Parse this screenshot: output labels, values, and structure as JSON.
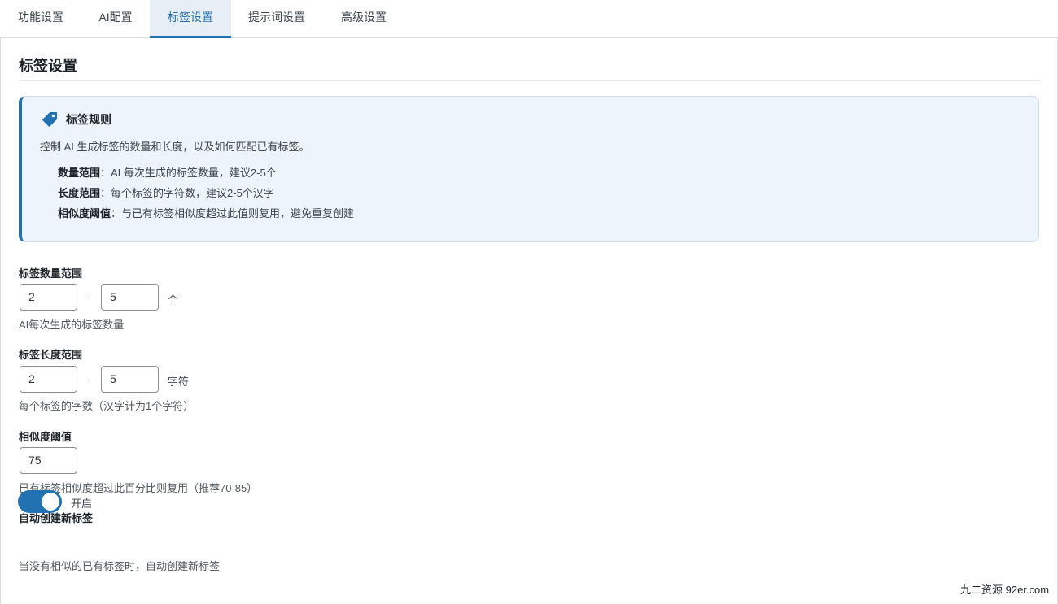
{
  "tabs": [
    {
      "label": "功能设置"
    },
    {
      "label": "AI配置"
    },
    {
      "label": "标签设置"
    },
    {
      "label": "提示词设置"
    },
    {
      "label": "高级设置"
    }
  ],
  "page": {
    "title": "标签设置"
  },
  "info": {
    "title": "标签规则",
    "description": "控制 AI 生成标签的数量和长度，以及如何匹配已有标签。",
    "rules": [
      {
        "term": "数量范围",
        "text": "：AI 每次生成的标签数量，建议2-5个"
      },
      {
        "term": "长度范围",
        "text": "：每个标签的字符数，建议2-5个汉字"
      },
      {
        "term": "相似度阈值",
        "text": "：与已有标签相似度超过此值则复用，避免重复创建"
      }
    ]
  },
  "fields": {
    "count_range": {
      "label": "标签数量范围",
      "min": "2",
      "separator": "-",
      "max": "5",
      "unit": "个",
      "help": "AI每次生成的标签数量"
    },
    "length_range": {
      "label": "标签长度范围",
      "min": "2",
      "separator": "-",
      "max": "5",
      "unit": "字符",
      "help": "每个标签的字数（汉字计为1个字符）"
    },
    "similarity": {
      "label": "相似度阈值",
      "value": "75",
      "help": "已有标签相似度超过此百分比则复用（推荐70-85）"
    },
    "auto_create": {
      "label": "自动创建新标签",
      "enabled": true,
      "state_label": "开启",
      "help": "当没有相似的已有标签时，自动创建新标签"
    }
  },
  "watermark": "九二资源 92er.com",
  "colors": {
    "accent": "#2271b1",
    "info_bg": "#eef4fb",
    "active_tab_bg": "#e8eef5"
  },
  "icons": {
    "info_icon": "tag-icon"
  }
}
